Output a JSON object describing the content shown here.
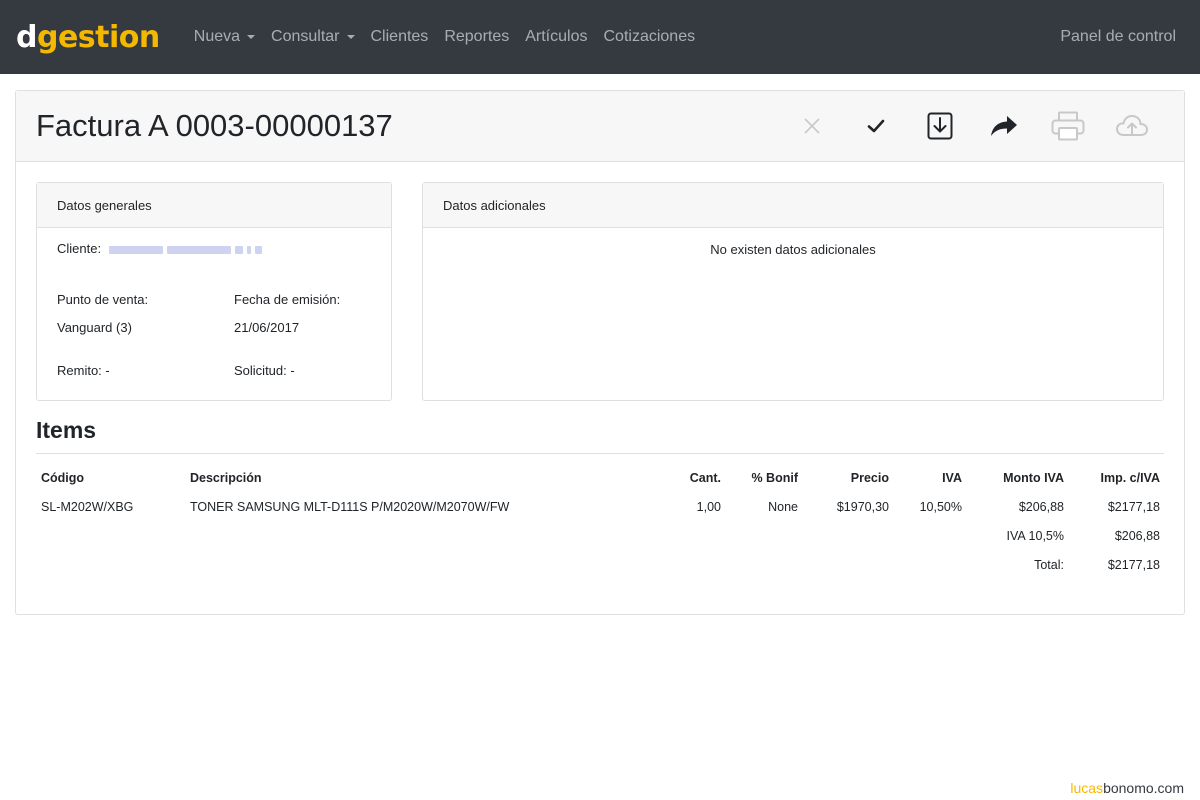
{
  "brand": {
    "part1": "d",
    "part2": "gestion"
  },
  "nav": {
    "items": [
      {
        "label": "Nueva",
        "dropdown": true
      },
      {
        "label": "Consultar",
        "dropdown": true
      },
      {
        "label": "Clientes"
      },
      {
        "label": "Reportes"
      },
      {
        "label": "Artículos"
      },
      {
        "label": "Cotizaciones"
      }
    ],
    "right": "Panel de control"
  },
  "invoice": {
    "title": "Factura A 0003-00000137",
    "actions": [
      "close-icon",
      "check-icon",
      "download-icon",
      "share-icon",
      "print-icon",
      "cloud-upload-icon"
    ]
  },
  "general": {
    "header": "Datos generales",
    "cliente_label": "Cliente:",
    "punto_venta_label": "Punto de venta:",
    "punto_venta_value": "Vanguard (3)",
    "fecha_label": "Fecha de emisión:",
    "fecha_value": "21/06/2017",
    "remito_label": "Remito:",
    "remito_value": "-",
    "solicitud_label": "Solicitud:",
    "solicitud_value": "-"
  },
  "additional": {
    "header": "Datos adicionales",
    "empty": "No existen datos adicionales"
  },
  "items": {
    "title": "Items",
    "columns": [
      "Código",
      "Descripción",
      "Cant.",
      "% Bonif",
      "Precio",
      "IVA",
      "Monto IVA",
      "Imp. c/IVA"
    ],
    "rows": [
      [
        "SL-M202W/XBG",
        "TONER SAMSUNG MLT-D111S P/M2020W/M2070W/FW",
        "1,00",
        "None",
        "$1970,30",
        "10,50%",
        "$206,88",
        "$2177,18"
      ]
    ],
    "iva_label": "IVA 10,5%",
    "iva_value": "$206,88",
    "total_label": "Total:",
    "total_value": "$2177,18"
  },
  "watermark": {
    "part1": "lucas",
    "part2": "bonomo.com"
  },
  "colors": {
    "navbar": "#343a40",
    "brand_accent": "#f5b800"
  }
}
